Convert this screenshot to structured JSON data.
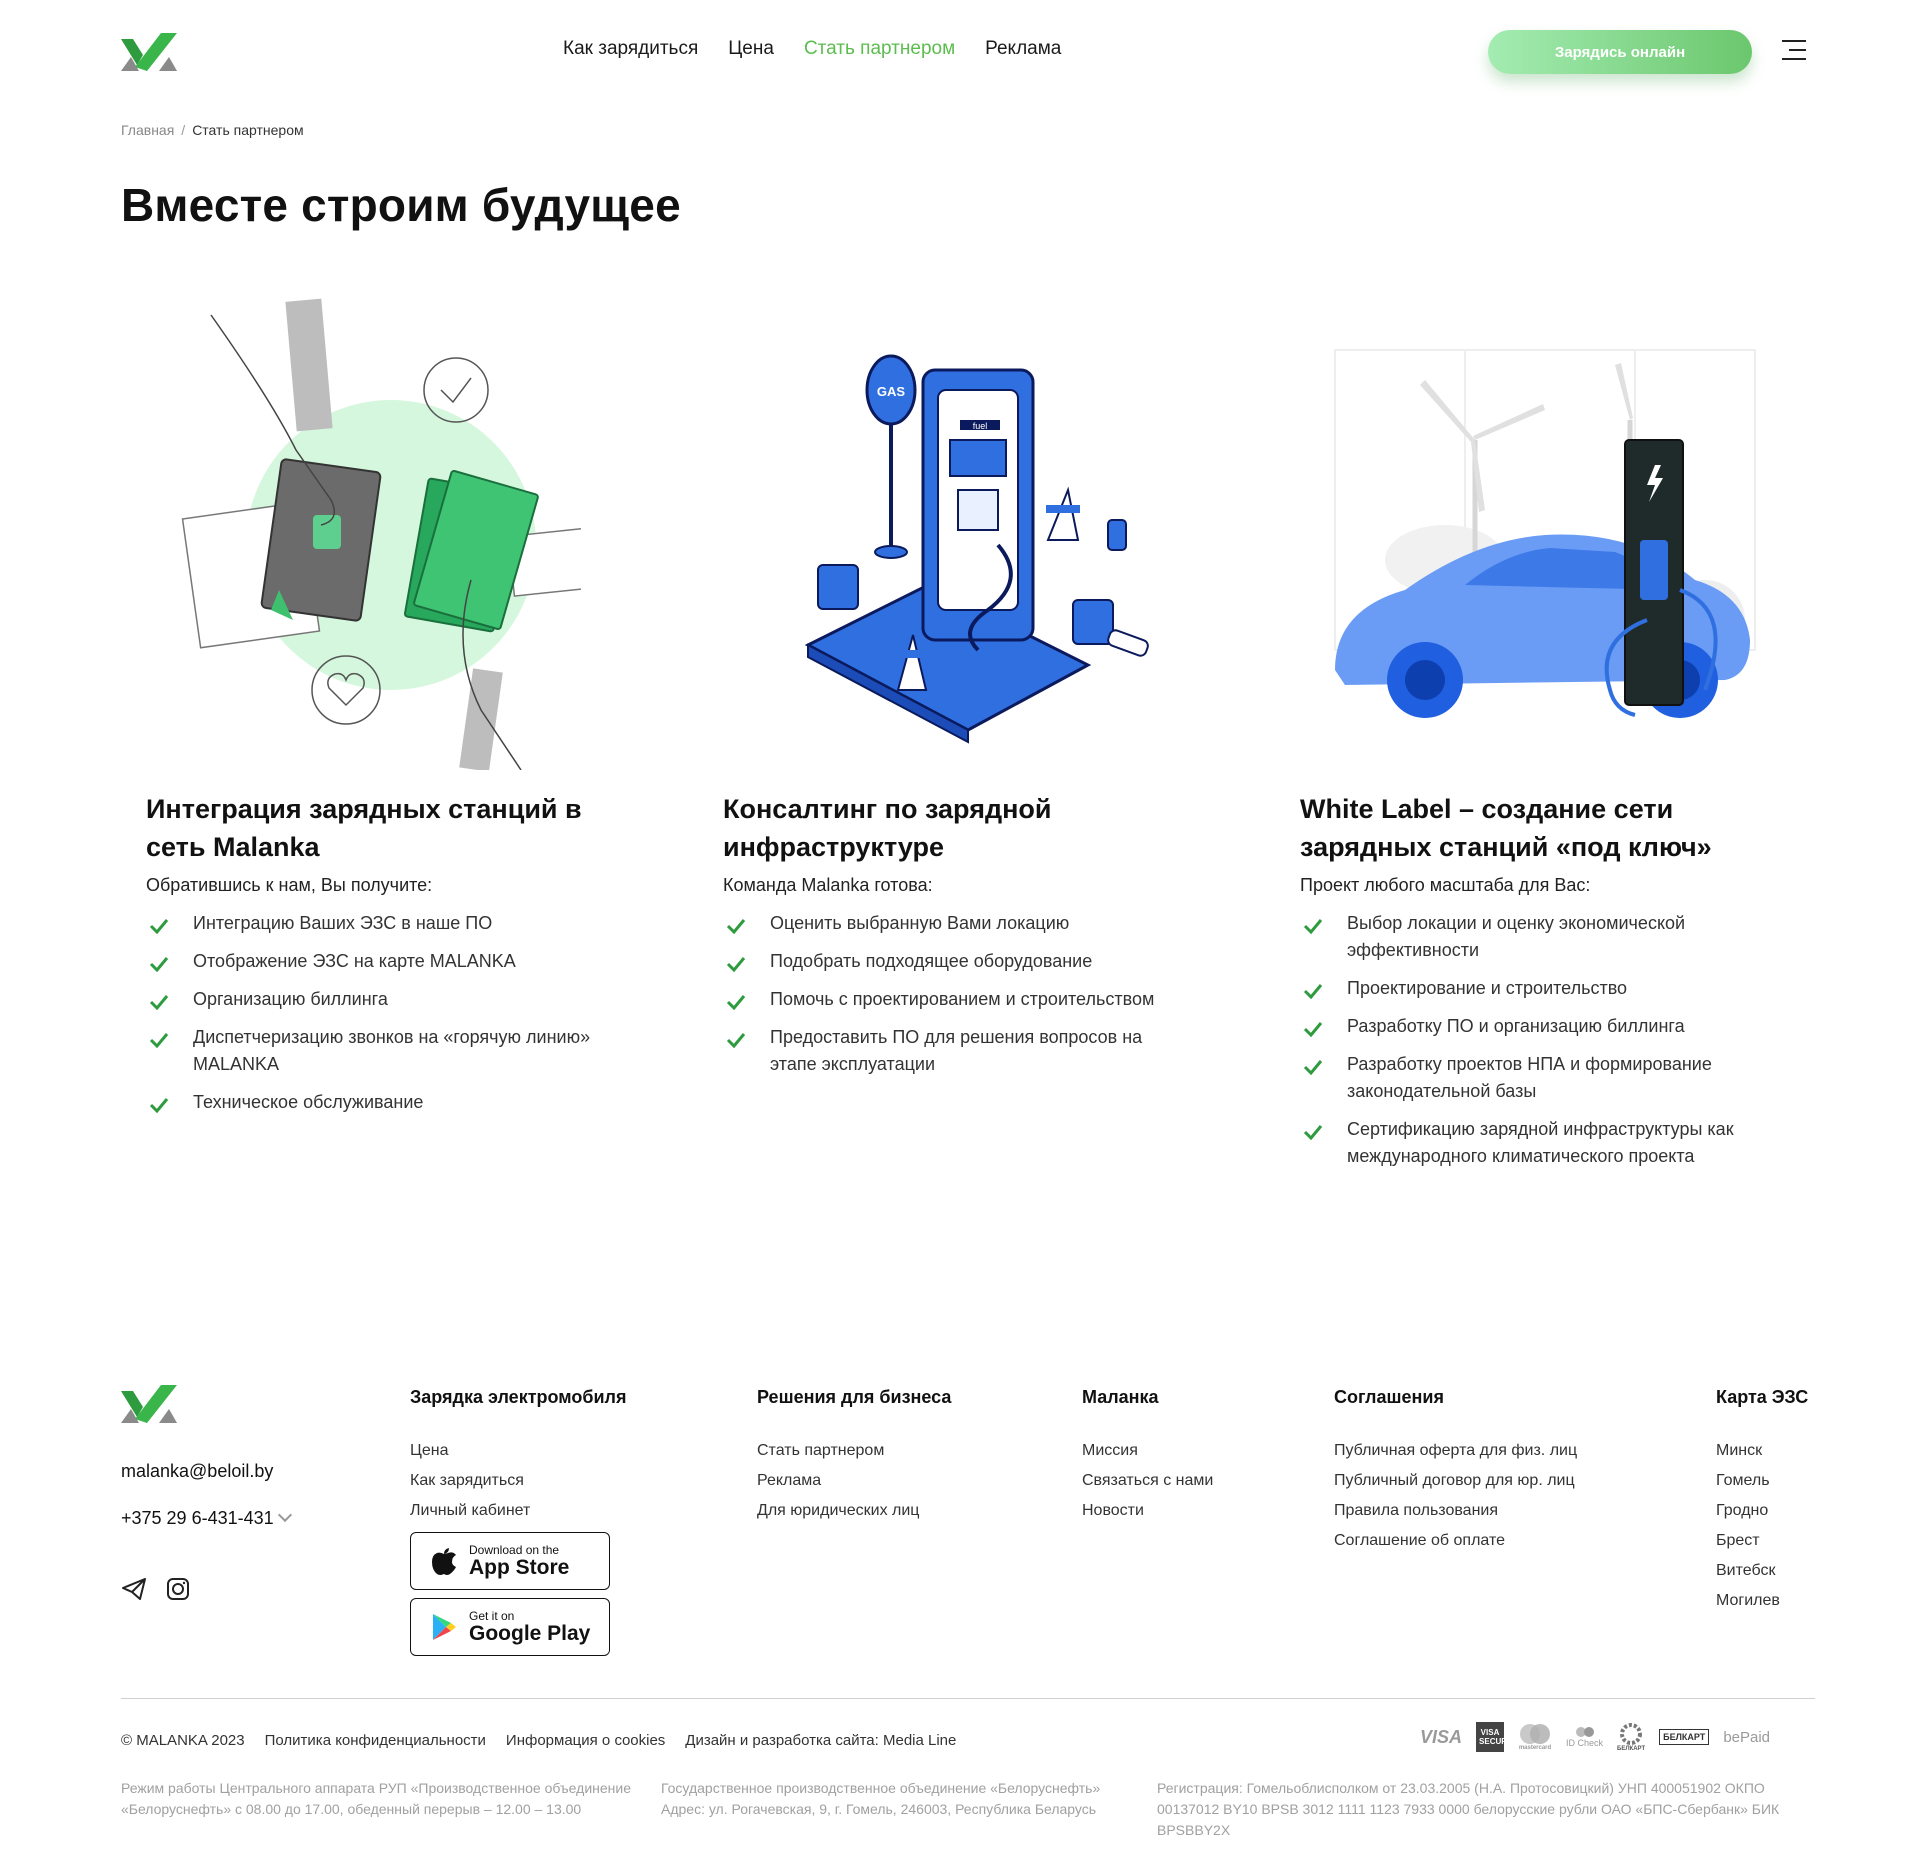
{
  "header": {
    "nav": [
      "Как зарядиться",
      "Цена",
      "Стать партнером",
      "Реклама"
    ],
    "cta_label": "Зарядись онлайн"
  },
  "breadcrumb": {
    "home": "Главная",
    "current": "Стать партнером"
  },
  "page_title": "Вместе строим будущее",
  "cards": [
    {
      "title": "Интеграция зарядных станций в сеть Malanka",
      "lead": "Обратившись к нам, Вы получите:",
      "items": [
        "Интеграцию Ваших ЭЗС в наше ПО",
        "Отображение ЭЗС на карте MALANKA",
        "Организацию биллинга",
        "Диспетчеризацию звонков на «горячую линию» MALANKA",
        "Техническое обслуживание"
      ]
    },
    {
      "title": "Консалтинг по зарядной инфраструктуре",
      "lead": "Команда Malanka готова:",
      "items": [
        "Оценить выбранную Вами локацию",
        "Подобрать подходящее оборудование",
        "Помочь с проектированием и строительством",
        "Предоставить ПО для решения вопросов на этапе эксплуатации"
      ]
    },
    {
      "title": "White Label – создание сети зарядных станций «под ключ»",
      "lead": "Проект любого масштаба для Вас:",
      "items": [
        "Выбор локации и оценку экономической эффективности",
        "Проектирование и строительство",
        "Разработку ПО и организацию биллинга",
        "Разработку проектов НПА и формирование законодательной базы",
        "Сертификацию зарядной инфраструктуры как международного климатического проекта"
      ]
    }
  ],
  "illustration_labels": {
    "gas_sign": "GAS",
    "fuel_label": "fuel"
  },
  "footer": {
    "email": "malanka@beloil.by",
    "phone": "+375 29 6-431-431",
    "columns": [
      {
        "title": "Зарядка электромобиля",
        "links": [
          "Цена",
          "Как зарядиться",
          "Личный кабинет"
        ]
      },
      {
        "title": "Решения для бизнеса",
        "links": [
          "Стать партнером",
          "Реклама",
          "Для юридических лиц"
        ]
      },
      {
        "title": "Маланка",
        "links": [
          "Миссия",
          "Связаться с нами",
          "Новости"
        ]
      },
      {
        "title": "Соглашения",
        "links": [
          "Публичная оферта для физ. лиц",
          "Публичный договор для юр. лиц",
          "Правила пользования",
          "Соглашение об оплате"
        ]
      },
      {
        "title": "Карта ЭЗС",
        "links": [
          "Минск",
          "Гомель",
          "Гродно",
          "Брест",
          "Витебск",
          "Могилев"
        ]
      }
    ],
    "stores": {
      "apple_small": "Download on the",
      "apple_big": "App Store",
      "google_small": "Get it on",
      "google_big": "Google Play"
    },
    "copyright": "© MALANKA 2023",
    "bottom_links": [
      "Политика конфиденциальности",
      "Информация о cookies",
      "Дизайн и разработка сайта: Media Line"
    ],
    "payments": [
      "VISA",
      "VISA SECURE",
      "mastercard",
      "ID Check",
      "БЕЛКАРТ",
      "БЕЛКАРТ",
      "bePaid"
    ],
    "legal": [
      "Режим работы Центрального аппарата РУП «Производственное объединение «Белоруснефть» с 08.00 до 17.00, обеденный перерыв – 12.00 – 13.00",
      "Государственное производственное объединение «Белоруснефть» Адрес: ул. Рогачевская, 9, г. Гомель, 246003, Республика Беларусь",
      "Регистрация: Гомельоблисполком от 23.03.2005 (Н.А. Протосовицкий) УНП 400051902 ОКПО 00137012 BY10 BPSB 3012 1111 1123 7933 0000 белорусские рубли ОАО «БПС-Сбербанк» БИК BPSBBY2X"
    ]
  },
  "colors": {
    "accent": "#5cbd4f",
    "brand_green": "#2e9b3e",
    "blue": "#2f6fe0",
    "light_green": "#d5f7dd"
  }
}
